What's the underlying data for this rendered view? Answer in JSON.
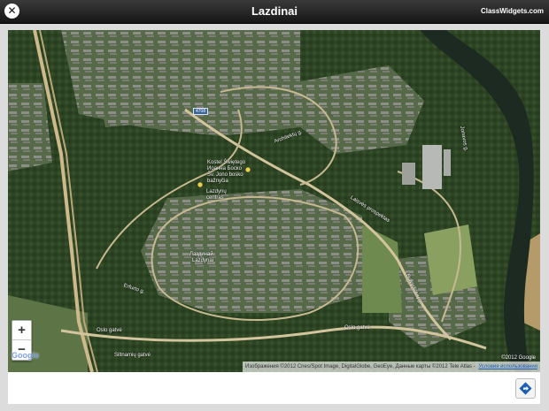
{
  "header": {
    "title": "Lazdinai",
    "brand": "ClassWidgets.com",
    "close_icon": "close-icon"
  },
  "map": {
    "type": "satellite",
    "route_badge": "4708",
    "labels": [
      {
        "id": "church",
        "text": "Kostel Świętego"
      },
      {
        "id": "church2",
        "text": "Иоанна Боско"
      },
      {
        "id": "church3",
        "text": "Šv. Jono bosko"
      },
      {
        "id": "church4",
        "text": "bažnyčia"
      },
      {
        "id": "center",
        "text": "Lazdynų"
      },
      {
        "id": "center2",
        "text": "centras"
      },
      {
        "id": "district",
        "text": "Лаздинай"
      },
      {
        "id": "district2",
        "text": "Lazdynai"
      },
      {
        "id": "street-architektu",
        "text": "Architektų g."
      },
      {
        "id": "street-laisves",
        "text": "Laisvės prospektas"
      },
      {
        "id": "street-oslo",
        "text": "Oslo gatvė"
      },
      {
        "id": "street-oslo2",
        "text": "Oslo gatvė"
      },
      {
        "id": "street-siltnamiu",
        "text": "Siltnamių gatvė"
      },
      {
        "id": "street-erfurto",
        "text": "Erfurto g."
      },
      {
        "id": "street-jonavos",
        "text": "Jonavos g."
      },
      {
        "id": "street-buivydiskiu",
        "text": "Buivydiškių g."
      }
    ],
    "zoom_in": "+",
    "zoom_out": "−",
    "google_logo": "Google",
    "copyright": "©2012 Google",
    "attribution": "Изображения ©2012 Cnes/Spot Image, DigitalGlobe, GeoEye, Данные карты ©2012 Tele Atlas -",
    "terms": "Условия использования"
  },
  "footer": {
    "directions_icon": "directions-icon"
  },
  "colors": {
    "header_bg": "#1c1c1c",
    "road": "#c8b88a",
    "river": "#1e2a22",
    "accent": "#1b5fb8"
  }
}
